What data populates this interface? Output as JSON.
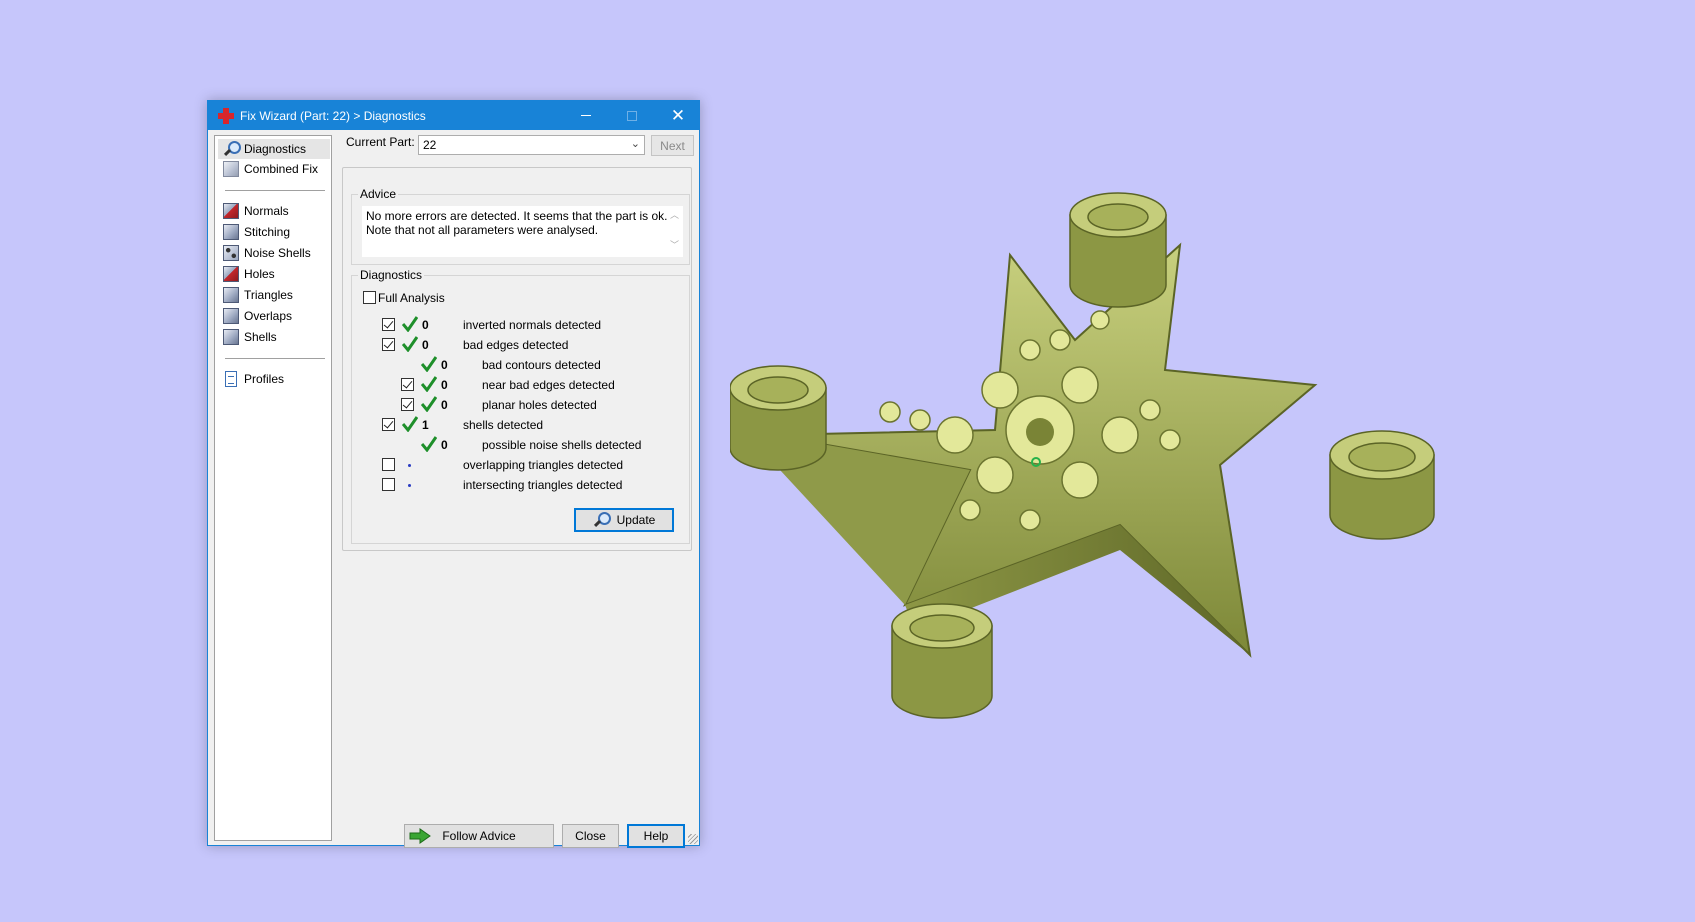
{
  "window": {
    "title": "Fix Wizard (Part: 22) > Diagnostics",
    "minimize_glyph": "─",
    "maximize_glyph": "☐",
    "close_glyph": "✕"
  },
  "sidebar": {
    "top_items": [
      {
        "label": "Diagnostics",
        "icon": "magnifier-icon",
        "selected": true
      },
      {
        "label": "Combined Fix",
        "icon": "cube-icon"
      }
    ],
    "tool_items": [
      {
        "label": "Normals",
        "icon": "normals-cube-icon"
      },
      {
        "label": "Stitching",
        "icon": "stitching-cube-icon"
      },
      {
        "label": "Noise Shells",
        "icon": "noise-shells-icon"
      },
      {
        "label": "Holes",
        "icon": "holes-cube-icon"
      },
      {
        "label": "Triangles",
        "icon": "triangles-cube-icon"
      },
      {
        "label": "Overlaps",
        "icon": "overlaps-cube-icon"
      },
      {
        "label": "Shells",
        "icon": "shells-cube-icon"
      }
    ],
    "bottom_items": [
      {
        "label": "Profiles",
        "icon": "profiles-document-icon"
      }
    ]
  },
  "current_part": {
    "label": "Current Part:",
    "value": "22",
    "next_label": "Next"
  },
  "advice": {
    "title": "Advice",
    "line1": "No more errors are detected. It seems that the part is ok.",
    "line2": "Note that not all parameters were analysed."
  },
  "diagnostics": {
    "title": "Diagnostics",
    "full_analysis_label": "Full Analysis",
    "full_analysis_checked": false,
    "rows": [
      {
        "checkbox": true,
        "checked": true,
        "status": "ok",
        "count": "0",
        "label": "inverted normals detected",
        "indent": 0
      },
      {
        "checkbox": true,
        "checked": true,
        "status": "ok",
        "count": "0",
        "label": "bad edges detected",
        "indent": 0
      },
      {
        "checkbox": false,
        "checked": false,
        "status": "ok",
        "count": "0",
        "label": "bad contours detected",
        "indent": 1
      },
      {
        "checkbox": true,
        "checked": true,
        "status": "ok",
        "count": "0",
        "label": "near bad edges detected",
        "indent": 1
      },
      {
        "checkbox": true,
        "checked": true,
        "status": "ok",
        "count": "0",
        "label": "planar holes detected",
        "indent": 1
      },
      {
        "checkbox": true,
        "checked": true,
        "status": "ok",
        "count": "1",
        "label": "shells detected",
        "indent": 0
      },
      {
        "checkbox": false,
        "checked": false,
        "status": "ok",
        "count": "0",
        "label": "possible noise shells detected",
        "indent": 1
      },
      {
        "checkbox": true,
        "checked": false,
        "status": "not-run",
        "count": "",
        "label": "overlapping triangles detected",
        "indent": 0
      },
      {
        "checkbox": true,
        "checked": false,
        "status": "not-run",
        "count": "",
        "label": "intersecting triangles detected",
        "indent": 0
      }
    ],
    "update_label": "Update"
  },
  "footer": {
    "follow_advice_label": "Follow Advice",
    "close_label": "Close",
    "help_label": "Help"
  },
  "colors": {
    "desktop": "#c6c6fb",
    "titlebar": "#1883d7",
    "model": "#a4b05c",
    "check_green": "#1e8f2a"
  }
}
